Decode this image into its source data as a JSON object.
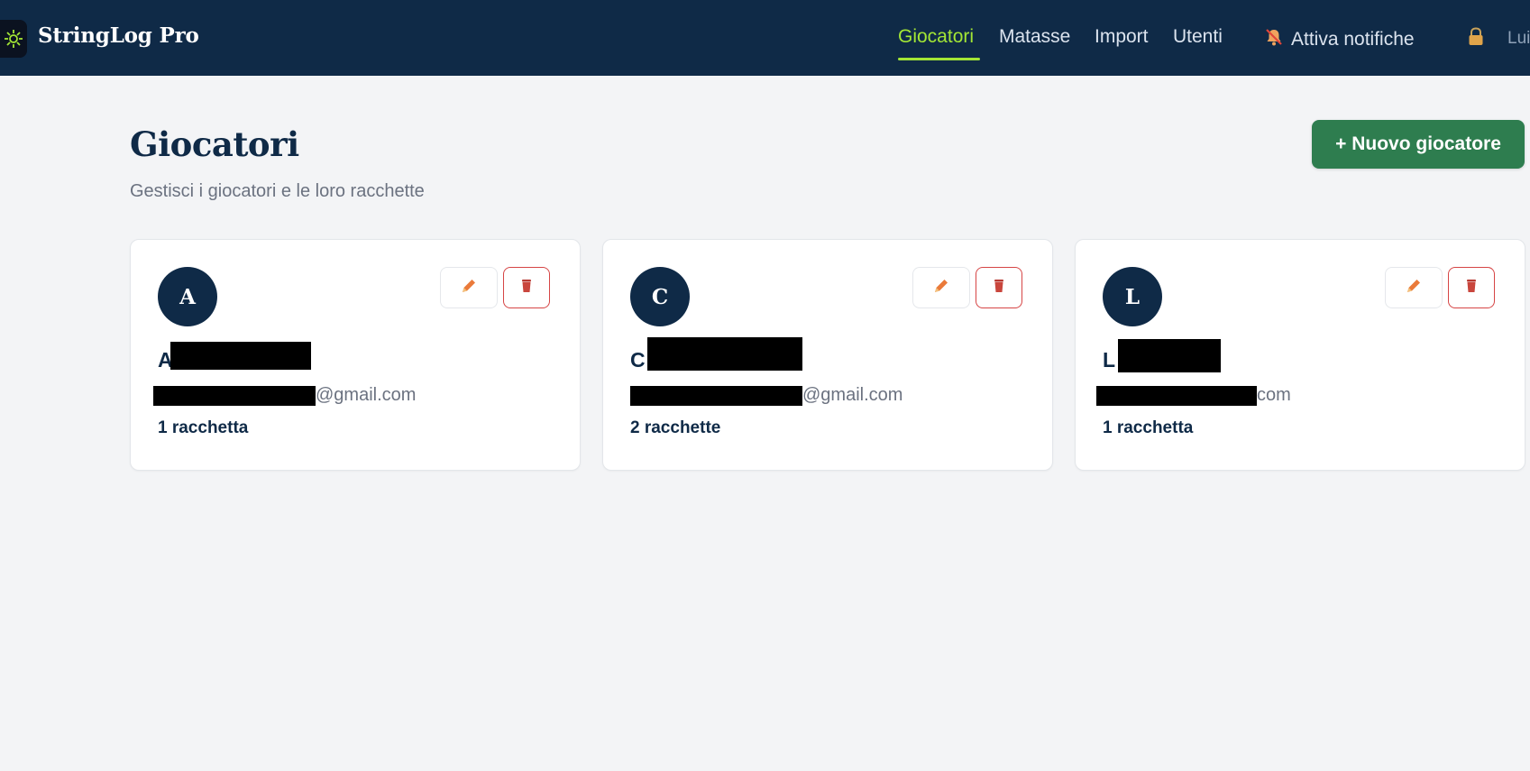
{
  "app": {
    "title": "StringLog Pro",
    "logo_icon": "tennis-racquet-icon"
  },
  "nav": {
    "items": [
      {
        "label": "Giocatori",
        "active": true
      },
      {
        "label": "Matasse",
        "active": false
      },
      {
        "label": "Import",
        "active": false
      },
      {
        "label": "Utenti",
        "active": false
      }
    ],
    "notifications_label": "Attiva notifiche",
    "notifications_icon": "bell-off-icon",
    "lock_icon": "lock-icon",
    "user_label": "Lui"
  },
  "page": {
    "title": "Giocatori",
    "subtitle": "Gestisci i giocatori e le loro racchette",
    "new_button": "+ Nuovo giocatore"
  },
  "players": [
    {
      "initial": "A",
      "name_visible": "A",
      "email_visible": "@gmail.com",
      "racquets": "1 racchetta"
    },
    {
      "initial": "C",
      "name_visible": "C",
      "email_visible": "@gmail.com",
      "racquets": "2 racchette"
    },
    {
      "initial": "L",
      "name_visible": "L",
      "email_visible": "com",
      "racquets": "1 racchetta"
    }
  ],
  "colors": {
    "header_bg": "#0f2a47",
    "accent": "#a3e635",
    "primary_button": "#2e7d4f",
    "danger": "#d64545",
    "edit_icon": "#ea7a3a"
  }
}
